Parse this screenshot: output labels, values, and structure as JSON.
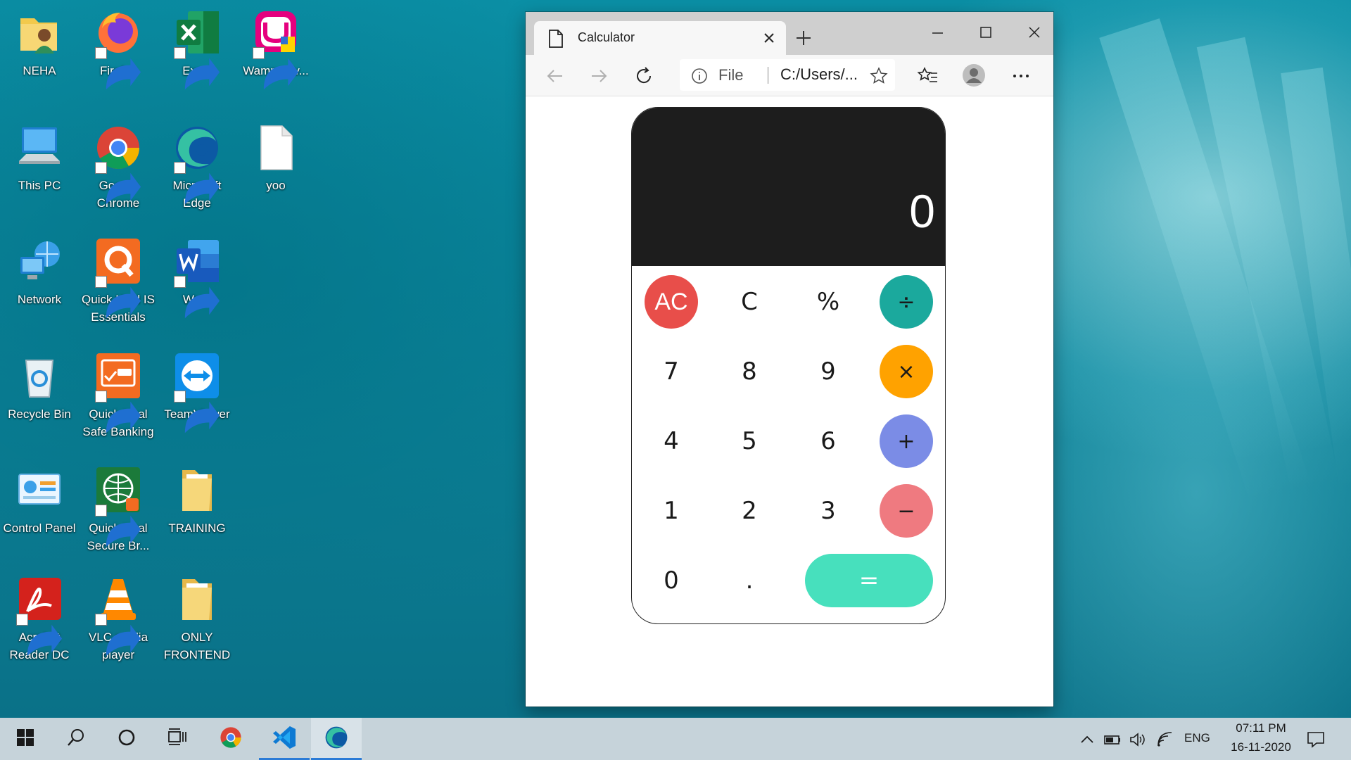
{
  "desktop": {
    "icons": [
      {
        "label": "NEHA"
      },
      {
        "label": "Firefox"
      },
      {
        "label": "Excel"
      },
      {
        "label": "Wampserv..."
      },
      {
        "label": "This PC"
      },
      {
        "label": "Google Chrome"
      },
      {
        "label": "Microsoft Edge"
      },
      {
        "label": "yoo"
      },
      {
        "label": "Network"
      },
      {
        "label": "Quick Heal IS Essentials"
      },
      {
        "label": "Word"
      },
      {
        "label": "Recycle Bin"
      },
      {
        "label": "Quick Heal Safe Banking"
      },
      {
        "label": "TeamViewer"
      },
      {
        "label": "Control Panel"
      },
      {
        "label": "Quick Heal Secure Br..."
      },
      {
        "label": "TRAINING"
      },
      {
        "label": "Acrobat Reader DC"
      },
      {
        "label": "VLC media player"
      },
      {
        "label": "ONLY FRONTEND"
      }
    ]
  },
  "browser": {
    "tab": {
      "title": "Calculator"
    },
    "address": {
      "scheme_label": "File",
      "url": "C:/Users/..."
    }
  },
  "calculator": {
    "display": "0",
    "keys": {
      "ac": "AC",
      "clear": "C",
      "percent": "%",
      "divide": "÷",
      "seven": "7",
      "eight": "8",
      "nine": "9",
      "multiply": "×",
      "four": "4",
      "five": "5",
      "six": "6",
      "add": "+",
      "one": "1",
      "two": "2",
      "three": "3",
      "subtract": "−",
      "zero": "0",
      "dot": ".",
      "equals": "="
    },
    "colors": {
      "ac": "#e84e4a",
      "divide": "#1ba99d",
      "multiply": "#ffa200",
      "add": "#7b8ce6",
      "subtract": "#ef7a80",
      "equals": "#47e0bd",
      "display_bg": "#1d1d1d"
    }
  },
  "taskbar": {
    "pinned": [
      "start-icon",
      "search-icon",
      "cortana-icon",
      "task-view-icon",
      "chrome-icon",
      "vscode-icon",
      "edge-icon"
    ],
    "tray": {
      "language": "ENG",
      "time": "07:11 PM",
      "date": "16-11-2020"
    }
  }
}
